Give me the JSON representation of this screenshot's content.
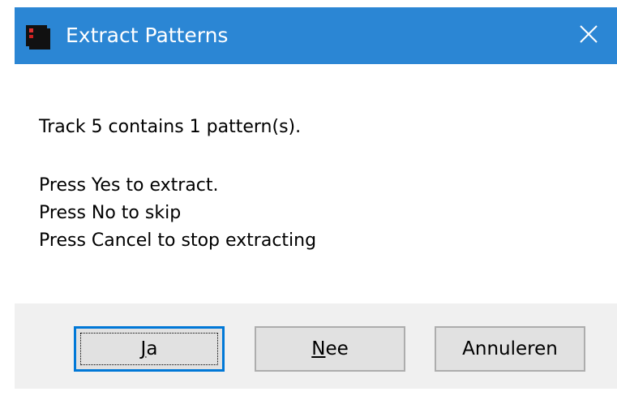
{
  "dialog": {
    "title": "Extract Patterns",
    "close_icon": "close-icon",
    "app_icon": "app-icon",
    "message_line1": "Track 5 contains 1 pattern(s).",
    "message_line2": "Press Yes to extract.",
    "message_line3": "Press No to skip",
    "message_line4": "Press Cancel to stop extracting",
    "buttons": {
      "yes": {
        "mnemonic": "J",
        "rest": "a"
      },
      "no": {
        "mnemonic": "N",
        "rest": "ee"
      },
      "cancel": {
        "label": "Annuleren"
      }
    }
  },
  "colors": {
    "titlebar": "#2b86d4",
    "footer": "#f0f0f0",
    "button": "#e1e1e1",
    "default_border": "#0078d7"
  }
}
